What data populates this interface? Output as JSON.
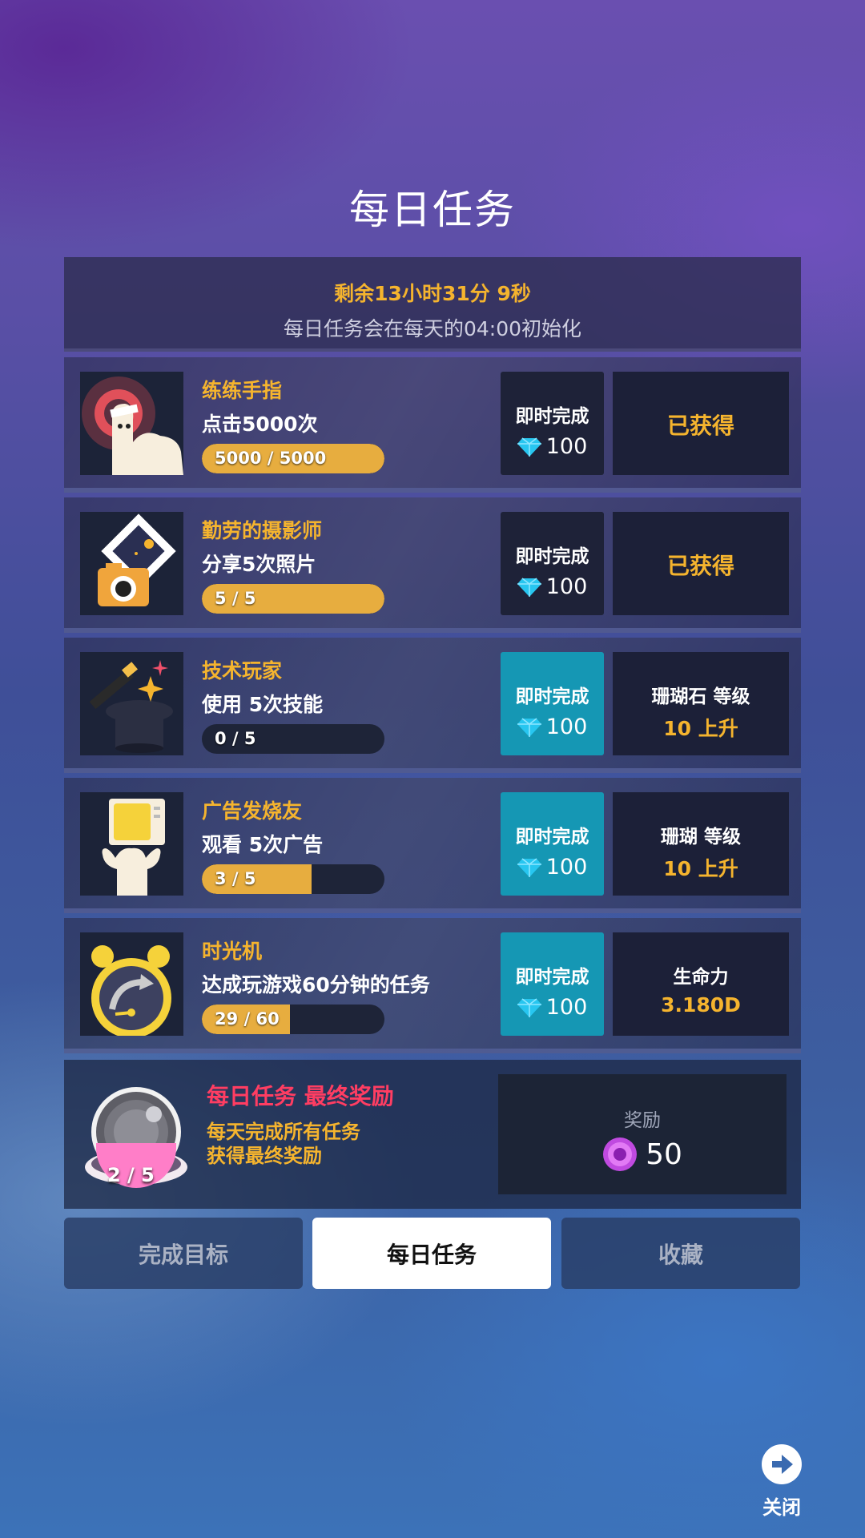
{
  "title": "每日任务",
  "timer": {
    "remaining": "剩余13小时31分 9秒",
    "reset_note": "每日任务会在每天的04:00初始化"
  },
  "instant": {
    "label": "即时完成",
    "cost": "100"
  },
  "tasks": [
    {
      "name": "练练手指",
      "desc": "点击5000次",
      "progress_text": "5000 / 5000",
      "progress": 1.0,
      "instant_active": false,
      "reward_line1": "已获得",
      "reward_line2": "",
      "claimed": true,
      "icon": "finger-tap-icon"
    },
    {
      "name": "勤劳的摄影师",
      "desc": "分享5次照片",
      "progress_text": "5 / 5",
      "progress": 1.0,
      "instant_active": false,
      "reward_line1": "已获得",
      "reward_line2": "",
      "claimed": true,
      "icon": "camera-photo-icon"
    },
    {
      "name": "技术玩家",
      "desc": "使用 5次技能",
      "progress_text": "0 / 5",
      "progress": 0.0,
      "instant_active": true,
      "reward_line1": "珊瑚石 等级",
      "reward_line2": "10 上升",
      "claimed": false,
      "icon": "magic-hat-icon"
    },
    {
      "name": "广告发烧友",
      "desc": "观看 5次广告",
      "progress_text": "3 / 5",
      "progress": 0.6,
      "instant_active": true,
      "reward_line1": "珊瑚 等级",
      "reward_line2": "10 上升",
      "claimed": false,
      "icon": "tv-watch-icon"
    },
    {
      "name": "时光机",
      "desc": "达成玩游戏60分钟的任务",
      "progress_text": "29 / 60",
      "progress": 0.483,
      "instant_active": true,
      "reward_line1": "生命力",
      "reward_line2": "3.180D",
      "claimed": false,
      "icon": "alarm-clock-icon"
    }
  ],
  "final": {
    "title": "每日任务 最终奖励",
    "desc_line1": "每天完成所有任务",
    "desc_line2": "获得最终奖励",
    "count": "2 / 5",
    "reward_label": "奖励",
    "reward_value": "50",
    "icon": "pearl-shell-icon"
  },
  "tabs": [
    {
      "label": "完成目标",
      "active": false
    },
    {
      "label": "每日任务",
      "active": true
    },
    {
      "label": "收藏",
      "active": false
    }
  ],
  "close": {
    "label": "关闭"
  },
  "colors": {
    "accent_gold": "#f5b42e",
    "accent_red": "#ff3d62",
    "instant_active": "#1597b4",
    "progress_fill": "#e7ad3f"
  }
}
